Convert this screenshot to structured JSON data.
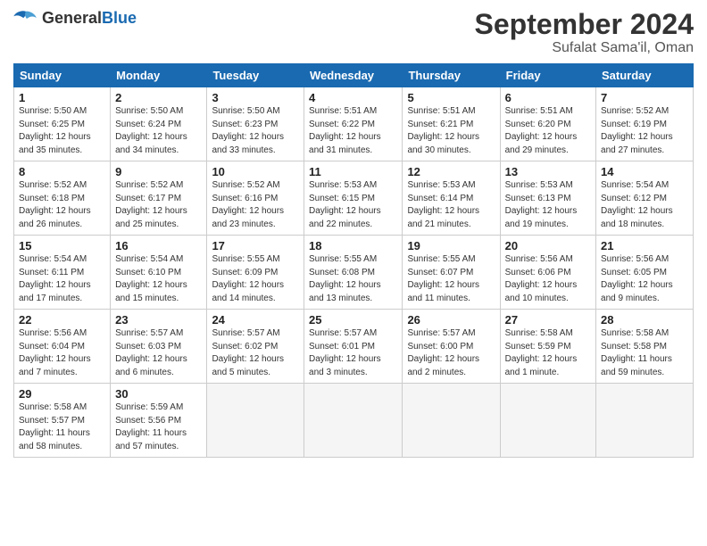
{
  "header": {
    "logo": {
      "general": "General",
      "blue": "Blue"
    },
    "title": "September 2024",
    "subtitle": "Sufalat Sama'il, Oman"
  },
  "days_of_week": [
    "Sunday",
    "Monday",
    "Tuesday",
    "Wednesday",
    "Thursday",
    "Friday",
    "Saturday"
  ],
  "weeks": [
    [
      {
        "day": 1,
        "info": "Sunrise: 5:50 AM\nSunset: 6:25 PM\nDaylight: 12 hours\nand 35 minutes."
      },
      {
        "day": 2,
        "info": "Sunrise: 5:50 AM\nSunset: 6:24 PM\nDaylight: 12 hours\nand 34 minutes."
      },
      {
        "day": 3,
        "info": "Sunrise: 5:50 AM\nSunset: 6:23 PM\nDaylight: 12 hours\nand 33 minutes."
      },
      {
        "day": 4,
        "info": "Sunrise: 5:51 AM\nSunset: 6:22 PM\nDaylight: 12 hours\nand 31 minutes."
      },
      {
        "day": 5,
        "info": "Sunrise: 5:51 AM\nSunset: 6:21 PM\nDaylight: 12 hours\nand 30 minutes."
      },
      {
        "day": 6,
        "info": "Sunrise: 5:51 AM\nSunset: 6:20 PM\nDaylight: 12 hours\nand 29 minutes."
      },
      {
        "day": 7,
        "info": "Sunrise: 5:52 AM\nSunset: 6:19 PM\nDaylight: 12 hours\nand 27 minutes."
      }
    ],
    [
      {
        "day": 8,
        "info": "Sunrise: 5:52 AM\nSunset: 6:18 PM\nDaylight: 12 hours\nand 26 minutes."
      },
      {
        "day": 9,
        "info": "Sunrise: 5:52 AM\nSunset: 6:17 PM\nDaylight: 12 hours\nand 25 minutes."
      },
      {
        "day": 10,
        "info": "Sunrise: 5:52 AM\nSunset: 6:16 PM\nDaylight: 12 hours\nand 23 minutes."
      },
      {
        "day": 11,
        "info": "Sunrise: 5:53 AM\nSunset: 6:15 PM\nDaylight: 12 hours\nand 22 minutes."
      },
      {
        "day": 12,
        "info": "Sunrise: 5:53 AM\nSunset: 6:14 PM\nDaylight: 12 hours\nand 21 minutes."
      },
      {
        "day": 13,
        "info": "Sunrise: 5:53 AM\nSunset: 6:13 PM\nDaylight: 12 hours\nand 19 minutes."
      },
      {
        "day": 14,
        "info": "Sunrise: 5:54 AM\nSunset: 6:12 PM\nDaylight: 12 hours\nand 18 minutes."
      }
    ],
    [
      {
        "day": 15,
        "info": "Sunrise: 5:54 AM\nSunset: 6:11 PM\nDaylight: 12 hours\nand 17 minutes."
      },
      {
        "day": 16,
        "info": "Sunrise: 5:54 AM\nSunset: 6:10 PM\nDaylight: 12 hours\nand 15 minutes."
      },
      {
        "day": 17,
        "info": "Sunrise: 5:55 AM\nSunset: 6:09 PM\nDaylight: 12 hours\nand 14 minutes."
      },
      {
        "day": 18,
        "info": "Sunrise: 5:55 AM\nSunset: 6:08 PM\nDaylight: 12 hours\nand 13 minutes."
      },
      {
        "day": 19,
        "info": "Sunrise: 5:55 AM\nSunset: 6:07 PM\nDaylight: 12 hours\nand 11 minutes."
      },
      {
        "day": 20,
        "info": "Sunrise: 5:56 AM\nSunset: 6:06 PM\nDaylight: 12 hours\nand 10 minutes."
      },
      {
        "day": 21,
        "info": "Sunrise: 5:56 AM\nSunset: 6:05 PM\nDaylight: 12 hours\nand 9 minutes."
      }
    ],
    [
      {
        "day": 22,
        "info": "Sunrise: 5:56 AM\nSunset: 6:04 PM\nDaylight: 12 hours\nand 7 minutes."
      },
      {
        "day": 23,
        "info": "Sunrise: 5:57 AM\nSunset: 6:03 PM\nDaylight: 12 hours\nand 6 minutes."
      },
      {
        "day": 24,
        "info": "Sunrise: 5:57 AM\nSunset: 6:02 PM\nDaylight: 12 hours\nand 5 minutes."
      },
      {
        "day": 25,
        "info": "Sunrise: 5:57 AM\nSunset: 6:01 PM\nDaylight: 12 hours\nand 3 minutes."
      },
      {
        "day": 26,
        "info": "Sunrise: 5:57 AM\nSunset: 6:00 PM\nDaylight: 12 hours\nand 2 minutes."
      },
      {
        "day": 27,
        "info": "Sunrise: 5:58 AM\nSunset: 5:59 PM\nDaylight: 12 hours\nand 1 minute."
      },
      {
        "day": 28,
        "info": "Sunrise: 5:58 AM\nSunset: 5:58 PM\nDaylight: 11 hours\nand 59 minutes."
      }
    ],
    [
      {
        "day": 29,
        "info": "Sunrise: 5:58 AM\nSunset: 5:57 PM\nDaylight: 11 hours\nand 58 minutes."
      },
      {
        "day": 30,
        "info": "Sunrise: 5:59 AM\nSunset: 5:56 PM\nDaylight: 11 hours\nand 57 minutes."
      },
      null,
      null,
      null,
      null,
      null
    ]
  ]
}
